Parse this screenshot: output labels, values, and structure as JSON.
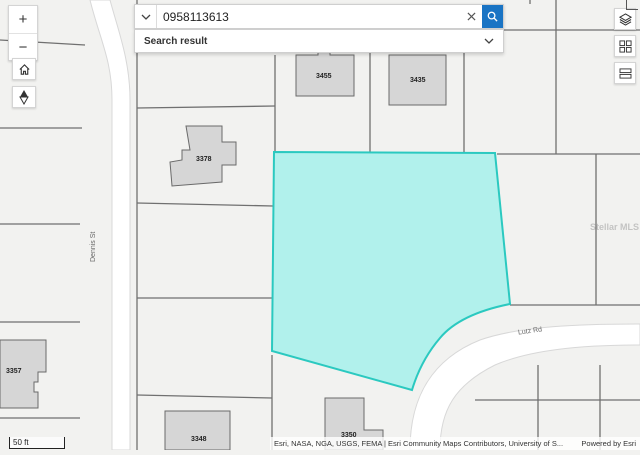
{
  "search": {
    "value": "0958113613",
    "dropdown_icon": "chevron-down-icon",
    "clear_icon": "close-icon",
    "submit_icon": "search-icon"
  },
  "result_panel": {
    "label": "Search result"
  },
  "controls": {
    "zoom_in": "+",
    "zoom_out": "−",
    "home_icon": "home-icon",
    "compass_icon": "compass-icon",
    "layers_icon": "layers-icon",
    "basemap_icon": "grid-icon",
    "legend_icon": "legend-icon"
  },
  "parcels": {
    "p3455": "3455",
    "p3435": "3435",
    "p3378": "3378",
    "p3357": "3357",
    "p3348": "3348",
    "p3350": "3350"
  },
  "streets": {
    "dennis": "Dennis St",
    "lutz": "Lutz Rd"
  },
  "scale": "50 ft",
  "attribution": {
    "left": "Esri, NASA, NGA, USGS, FEMA | Esri Community Maps Contributors, University of S...",
    "right": "Powered by Esri"
  },
  "watermark": "Stellar MLS",
  "colors": {
    "highlight_fill": "#b1f1ec",
    "highlight_stroke": "#2bc9c0",
    "road": "#ffffff",
    "building": "#d6d6d6",
    "accent": "#1a74c4"
  }
}
